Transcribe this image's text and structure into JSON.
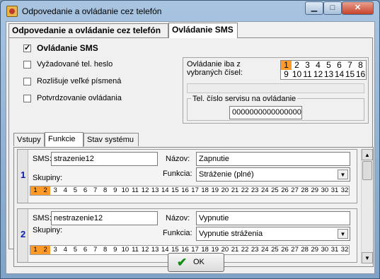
{
  "window": {
    "title": "Odpovedanie a ovládanie cez telefón",
    "minimize": "▁",
    "maximize": "□",
    "close": "✕"
  },
  "main_tabs": [
    {
      "label": "Odpovedanie a ovládanie cez telefón",
      "active": false
    },
    {
      "label": "Ovládanie SMS",
      "active": true
    }
  ],
  "options": {
    "sms_control": {
      "label": "Ovládanie SMS",
      "checked": true
    },
    "require_password": {
      "label": "Vyžadované tel. heslo",
      "checked": false
    },
    "case_sensitive": {
      "label": "Rozlišuje veľké písmená",
      "checked": false
    },
    "confirm_control": {
      "label": "Potvrdzovanie ovládania",
      "checked": false
    }
  },
  "selected_numbers": {
    "label_line1": "Ovládanie iba z",
    "label_line2": "vybraných čísel:",
    "numbers": [
      "1",
      "2",
      "3",
      "4",
      "5",
      "6",
      "7",
      "8",
      "9",
      "10",
      "11",
      "12",
      "13",
      "14",
      "15",
      "16"
    ],
    "selected": [
      "1"
    ]
  },
  "service_number": {
    "label": "Tel. číslo servisu na ovládanie",
    "value": "0000000000000000"
  },
  "sub_tabs": [
    {
      "label": "Vstupy",
      "active": false
    },
    {
      "label": "Funkcie",
      "active": true
    },
    {
      "label": "Stav systému",
      "active": false
    }
  ],
  "entries": [
    {
      "index": "1",
      "sms_label": "SMS:",
      "sms": "strazenie12",
      "name_label": "Názov:",
      "name": "Zapnutie",
      "function_label": "Funkcia:",
      "function": "Stráženie (plné)",
      "groups_label": "Skupiny:",
      "selected_groups": [
        "1",
        "2"
      ]
    },
    {
      "index": "2",
      "sms_label": "SMS:",
      "sms": "nestrazenie12",
      "name_label": "Názov:",
      "name": "Vypnutie",
      "function_label": "Funkcia:",
      "function": "Vypnutie stráženia",
      "groups_label": "Skupiny:",
      "selected_groups": [
        "1",
        "2"
      ]
    }
  ],
  "group_numbers": [
    "1",
    "2",
    "3",
    "4",
    "5",
    "6",
    "7",
    "8",
    "9",
    "10",
    "11",
    "12",
    "13",
    "14",
    "15",
    "16",
    "17",
    "18",
    "19",
    "20",
    "21",
    "22",
    "23",
    "24",
    "25",
    "26",
    "27",
    "28",
    "29",
    "30",
    "31",
    "32"
  ],
  "ok_button": {
    "label": "OK",
    "icon": "checkmark-icon"
  },
  "colors": {
    "selected": "#ff9a28",
    "index_blue": "#0a1ca8",
    "ok_green": "#168b16"
  }
}
